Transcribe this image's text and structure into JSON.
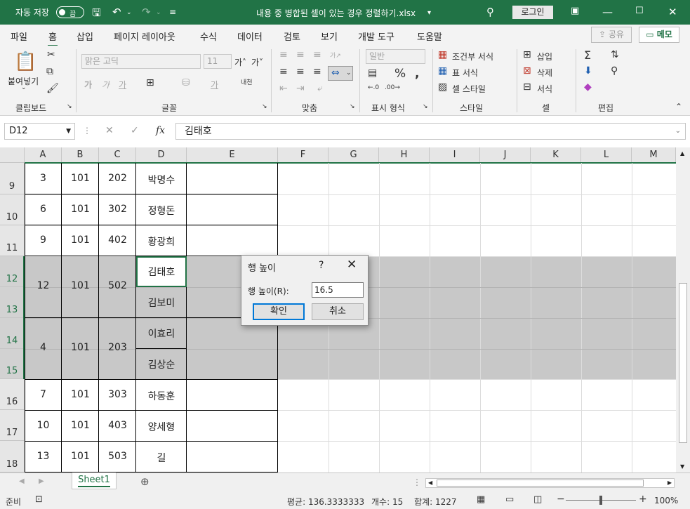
{
  "titlebar": {
    "autosave_label": "자동 저장",
    "autosave_state": "끔",
    "filename": "내용 중 병합된 셀이 있는 경우 정렬하기.xlsx",
    "login": "로그인",
    "icons": [
      "save-icon",
      "undo-icon",
      "redo-icon",
      "customize-icon",
      "search-icon",
      "ribbon-display-icon",
      "minimize-icon",
      "maximize-icon",
      "close-icon"
    ]
  },
  "menu": {
    "tabs": [
      "파일",
      "홈",
      "삽입",
      "페이지 레이아웃",
      "수식",
      "데이터",
      "검토",
      "보기",
      "개발 도구",
      "도움말"
    ],
    "active": "홈",
    "share": "공유",
    "memo": "메모"
  },
  "ribbon": {
    "clipboard": {
      "paste": "붙여넣기",
      "label": "클립보드"
    },
    "font": {
      "name": "맑은 고딕",
      "size": "11",
      "label": "글꼴"
    },
    "alignment": {
      "label": "맞춤"
    },
    "number": {
      "format": "일반",
      "label": "표시 형식"
    },
    "styles": {
      "conditional": "조건부 서식",
      "table": "표 서식",
      "cell": "셀 스타일",
      "label": "스타일"
    },
    "cells": {
      "insert": "삽입",
      "delete": "삭제",
      "format": "서식",
      "label": "셀"
    },
    "editing": {
      "label": "편집"
    }
  },
  "formula": {
    "namebox": "D12",
    "content": "김태호"
  },
  "grid": {
    "columns": [
      "A",
      "B",
      "C",
      "D",
      "E",
      "F",
      "G",
      "H",
      "I",
      "J",
      "K",
      "L",
      "M"
    ],
    "rows": [
      "9",
      "10",
      "11",
      "12",
      "13",
      "14",
      "15",
      "16",
      "17",
      "18"
    ],
    "cells": {
      "r9": [
        "3",
        "101",
        "202",
        "박명수"
      ],
      "r10": [
        "6",
        "101",
        "302",
        "정형돈"
      ],
      "r11": [
        "9",
        "101",
        "402",
        "황광희"
      ],
      "m12": [
        "12",
        "101",
        "502"
      ],
      "d12": "김태호",
      "d13": "김보미",
      "m14": [
        "4",
        "101",
        "203"
      ],
      "d14": "이효리",
      "d15": "김상순",
      "r16": [
        "7",
        "101",
        "303",
        "하동훈"
      ],
      "r17": [
        "10",
        "101",
        "403",
        "양세형"
      ],
      "r18": [
        "13",
        "101",
        "503",
        "길"
      ]
    }
  },
  "sheet": {
    "tab": "Sheet1"
  },
  "status": {
    "ready": "준비",
    "average": "평균: 136.3333333",
    "count": "개수: 15",
    "sum": "합계: 1227",
    "zoom": "100%"
  },
  "dialog": {
    "title": "행 높이",
    "help": "?",
    "label": "행 높이(R):",
    "value": "16.5",
    "ok": "확인",
    "cancel": "취소"
  }
}
